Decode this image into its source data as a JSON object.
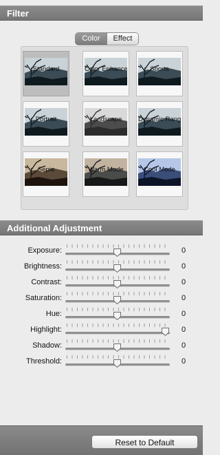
{
  "filter": {
    "title": "Filter",
    "tabs": [
      {
        "label": "Color",
        "active": true
      },
      {
        "label": "Effect",
        "active": false
      }
    ],
    "presets": [
      {
        "label": "Standard",
        "selected": true,
        "tone": "cool"
      },
      {
        "label": "Color Enhance",
        "selected": false,
        "tone": "cool"
      },
      {
        "label": "Sports",
        "selected": false,
        "tone": "cool"
      },
      {
        "label": "Portrait",
        "selected": false,
        "tone": "cool"
      },
      {
        "label": "Landscape",
        "selected": false,
        "tone": "pale"
      },
      {
        "label": "Dynamic Range",
        "selected": false,
        "tone": "cool"
      },
      {
        "label": "Sepia",
        "selected": false,
        "tone": "sepia"
      },
      {
        "label": "Warm Mode",
        "selected": false,
        "tone": "warm"
      },
      {
        "label": "Cool Mode",
        "selected": false,
        "tone": "blue"
      }
    ]
  },
  "adjust": {
    "title": "Additional Adjustment",
    "rows": [
      {
        "label": "Exposure:",
        "value": "0",
        "position": 0.5
      },
      {
        "label": "Brightness:",
        "value": "0",
        "position": 0.5
      },
      {
        "label": "Contrast:",
        "value": "0",
        "position": 0.5
      },
      {
        "label": "Saturation:",
        "value": "0",
        "position": 0.5
      },
      {
        "label": "Hue:",
        "value": "0",
        "position": 0.5
      },
      {
        "label": "Highlight:",
        "value": "0",
        "position": 1.0
      },
      {
        "label": "Shadow:",
        "value": "0",
        "position": 0.5
      },
      {
        "label": "Threshold:",
        "value": "0",
        "position": 0.5
      }
    ]
  },
  "footer": {
    "reset_label": "Reset to Default"
  }
}
